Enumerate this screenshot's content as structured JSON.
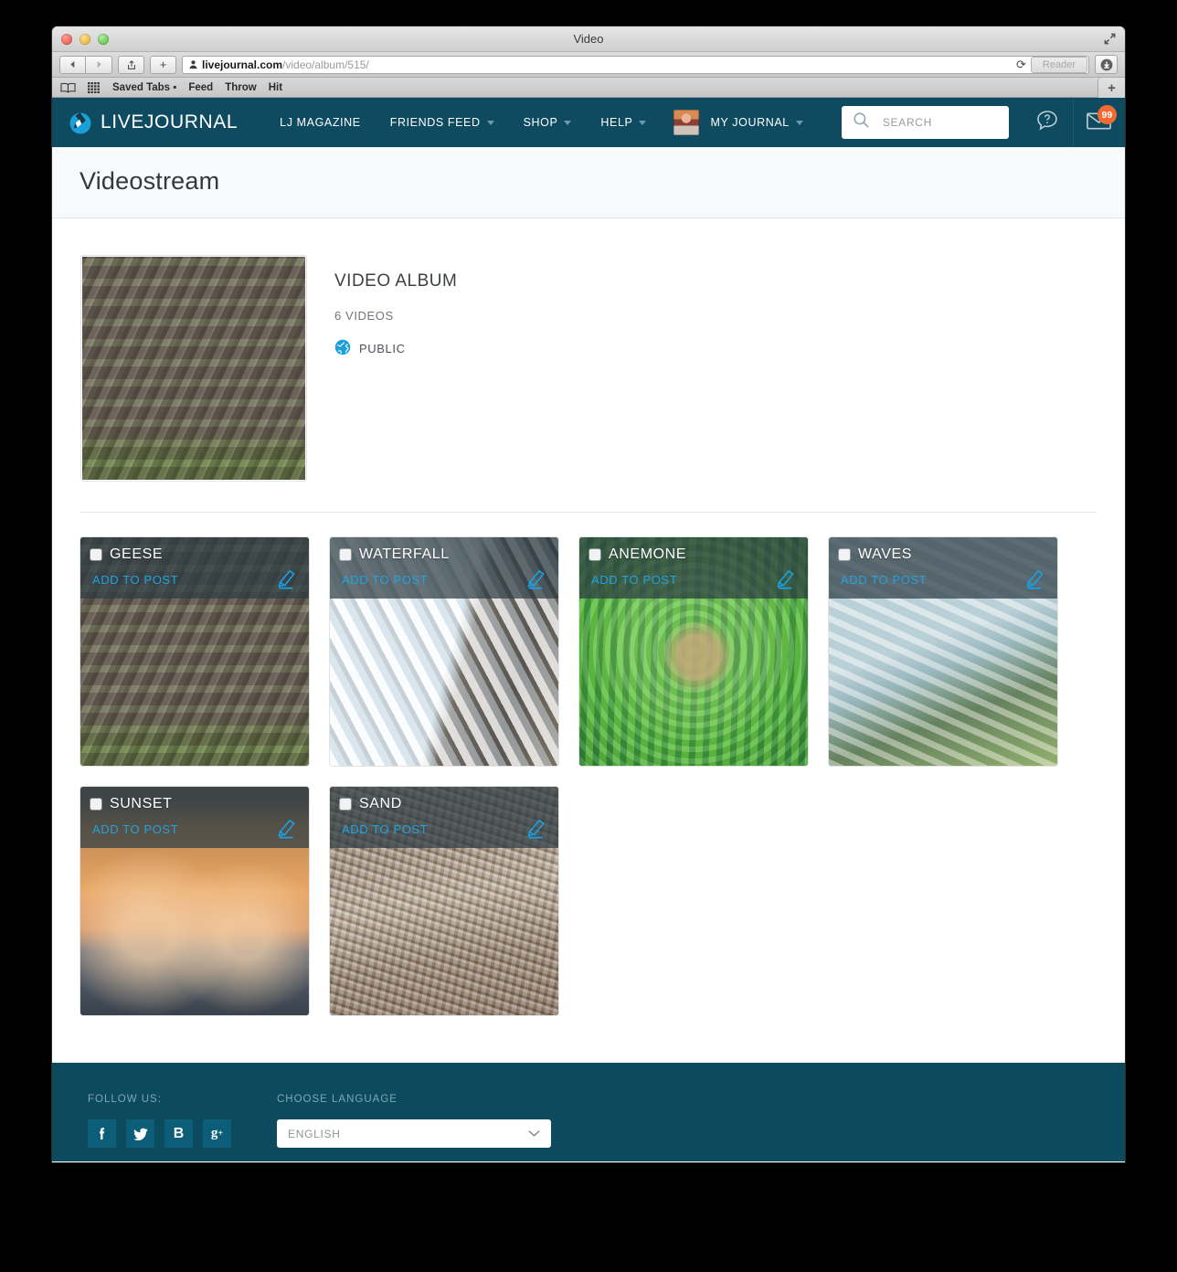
{
  "browser": {
    "window_title": "Video",
    "url_domain": "livejournal.com",
    "url_path": "/video/album/515/",
    "reader_label": "Reader",
    "bookmarks": [
      "Saved Tabs ▪",
      "Feed",
      "Throw",
      "Hit"
    ]
  },
  "nav": {
    "brand": "LIVEJOURNAL",
    "links": [
      {
        "label": "LJ MAGAZINE",
        "caret": false
      },
      {
        "label": "FRIENDS FEED",
        "caret": true
      },
      {
        "label": "SHOP",
        "caret": true
      },
      {
        "label": "HELP",
        "caret": true
      }
    ],
    "my_journal": "MY JOURNAL",
    "search_placeholder": "SEARCH",
    "message_badge": "99",
    "bar_color": "#0e4b60"
  },
  "page": {
    "title": "Videostream"
  },
  "album": {
    "name": "VIDEO ALBUM",
    "count": "6 VIDEOS",
    "privacy": "PUBLIC"
  },
  "cards": [
    {
      "title": "GEESE",
      "action": "ADD TO POST",
      "img": "img-geese"
    },
    {
      "title": "WATERFALL",
      "action": "ADD TO POST",
      "img": "img-waterfall"
    },
    {
      "title": "ANEMONE",
      "action": "ADD TO POST",
      "img": "img-anemone"
    },
    {
      "title": "WAVES",
      "action": "ADD TO POST",
      "img": "img-waves"
    },
    {
      "title": "SUNSET",
      "action": "ADD TO POST",
      "img": "img-sunset"
    },
    {
      "title": "SAND",
      "action": "ADD TO POST",
      "img": "img-sand"
    }
  ],
  "footer": {
    "follow_label": "FOLLOW US:",
    "socials": [
      "f",
      "twitter-bird",
      "B",
      "g+"
    ],
    "language_label": "CHOOSE LANGUAGE",
    "language_value": "ENGLISH",
    "bg_color": "#0c4a5e"
  }
}
